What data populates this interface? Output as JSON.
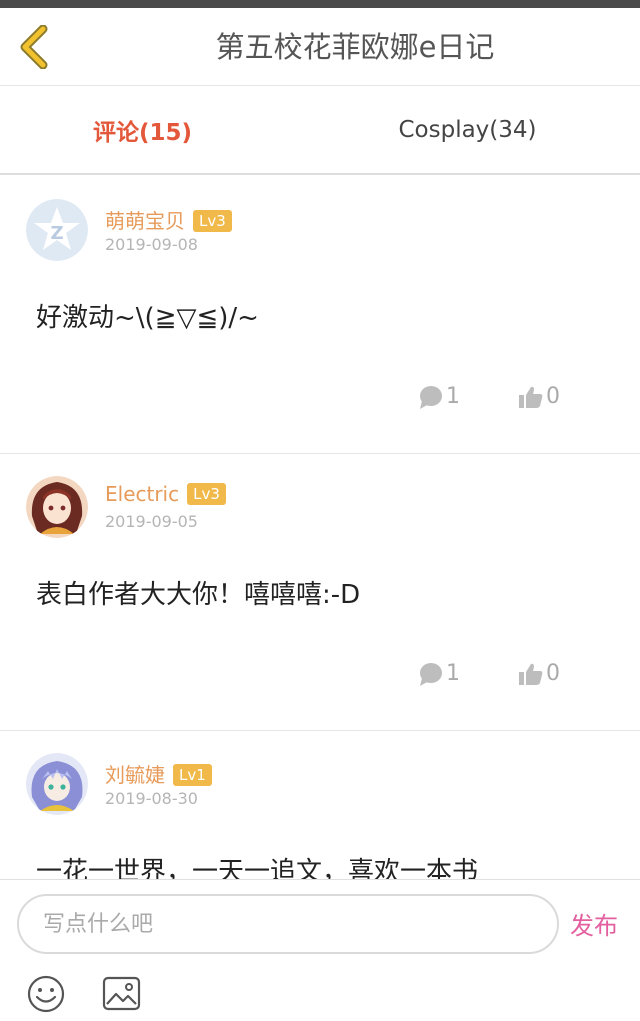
{
  "header": {
    "title": "第五校花菲欧娜e日记"
  },
  "tabs": [
    {
      "label": "评论(15)"
    },
    {
      "label": "Cosplay(34)"
    }
  ],
  "comments": [
    {
      "username": "萌萌宝贝",
      "level": "Lv3",
      "date": "2019-09-08",
      "content": "好激动~\\(≧▽≦)/~",
      "replies": "1",
      "likes": "0"
    },
    {
      "username": "Electric",
      "level": "Lv3",
      "date": "2019-09-05",
      "content": "表白作者大大你！嘻嘻嘻:-D",
      "replies": "1",
      "likes": "0"
    },
    {
      "username": "刘毓婕",
      "level": "Lv1",
      "date": "2019-08-30",
      "content": "一花一世界，一天一追文，喜欢一本书",
      "replies": "",
      "likes": ""
    }
  ],
  "footer": {
    "placeholder": "写点什么吧",
    "publish_label": "发布"
  },
  "icons": {
    "back": "chevron-left-icon",
    "reply": "speech-bubble-icon",
    "like": "thumbs-up-icon",
    "emoji": "smiley-icon",
    "image": "image-icon"
  },
  "colors": {
    "accent_tab": "#e3583a",
    "username": "#e79b5b",
    "level_badge": "#f0b94a",
    "publish": "#e35fa0",
    "back_icon": "#f2c12e"
  }
}
